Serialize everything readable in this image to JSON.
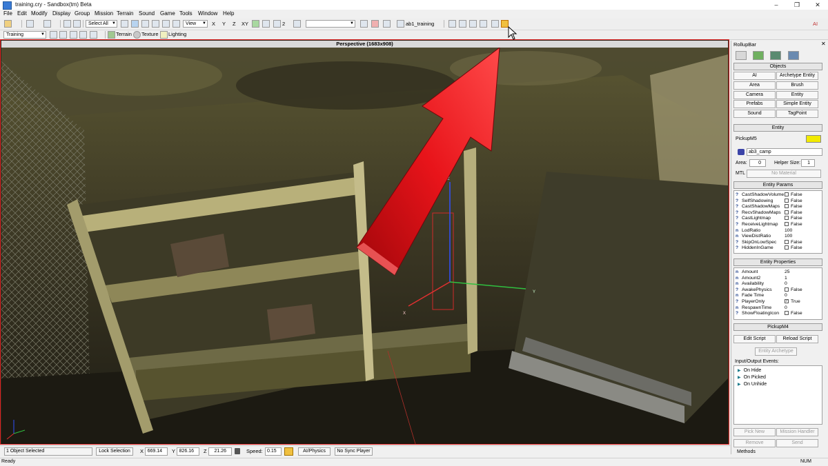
{
  "window": {
    "title": "training.cry - Sandbox(tm) Beta",
    "controls": [
      "–",
      "❐",
      "✕"
    ]
  },
  "menu": [
    "File",
    "Edit",
    "Modify",
    "Display",
    "Group",
    "Mission",
    "Terrain",
    "Sound",
    "Game",
    "Tools",
    "Window",
    "Help"
  ],
  "toolbar1": {
    "select_all_label": "Select All",
    "view_label": "View",
    "axes": [
      "X",
      "Y",
      "Z",
      "XY"
    ],
    "grid_value": "2",
    "layer_name": "ab1_training",
    "ai_label": "AI"
  },
  "toolbar2": {
    "mission_select": "Training",
    "terrain_label": "Terrain",
    "texture_label": "Texture",
    "lighting_label": "Lighting"
  },
  "viewport": {
    "title": "Perspective (1683x908)",
    "gizmo_axes": [
      "Z",
      "X",
      "Y"
    ]
  },
  "rollup": {
    "title": "RollupBar",
    "objects_header": "Objects",
    "object_buttons": [
      "AI",
      "Archetype Entity",
      "Area",
      "Brush",
      "Camera",
      "Entity",
      "Prefabs",
      "Simple Entity",
      "Sound",
      "TagPoint"
    ],
    "entity_header": "Entity",
    "entity_name": "PickupM5",
    "entity_color": "#f2ea00",
    "entity_material": "ab3_camp",
    "area_label": "Area:",
    "area_value": "0",
    "helper_size_label": "Helper Size:",
    "helper_size_value": "1",
    "mtl_label": "MTL",
    "no_material": "No Material",
    "entity_params_header": "Entity Params",
    "entity_params": [
      {
        "q": "?",
        "name": "CastShadowVolume",
        "value": "False"
      },
      {
        "q": "?",
        "name": "SelfShadowing",
        "value": "False"
      },
      {
        "q": "?",
        "name": "CastShadowMaps",
        "value": "False"
      },
      {
        "q": "?",
        "name": "RecvShadowMaps",
        "value": "False"
      },
      {
        "q": "?",
        "name": "CastLightmap",
        "value": "False"
      },
      {
        "q": "?",
        "name": "ReceiveLightmap",
        "value": "False"
      },
      {
        "q": "n",
        "name": "LodRatio",
        "value": "100"
      },
      {
        "q": "n",
        "name": "ViewDistRatio",
        "value": "100"
      },
      {
        "q": "?",
        "name": "SkipOnLowSpec",
        "value": "False"
      },
      {
        "q": "?",
        "name": "HiddenInGame",
        "value": "False"
      }
    ],
    "entity_properties_header": "Entity Properties",
    "entity_properties": [
      {
        "q": "n",
        "name": "Amount",
        "value": "25"
      },
      {
        "q": "n",
        "name": "Amount2",
        "value": "1"
      },
      {
        "q": "n",
        "name": "Availability",
        "value": "0"
      },
      {
        "q": "?",
        "name": "AwakePhysics",
        "value": "False"
      },
      {
        "q": "n",
        "name": "Fade Time",
        "value": "0"
      },
      {
        "q": "?",
        "name": "PlayerOnly",
        "value": "True"
      },
      {
        "q": "n",
        "name": "RespawnTime",
        "value": "0"
      },
      {
        "q": "?",
        "name": "ShowFloatingIcon",
        "value": "False"
      }
    ],
    "pickup_header": "PickupM4",
    "edit_script": "Edit Script",
    "reload_script": "Reload Script",
    "entity_archetype": "Entity Archetype",
    "io_events_label": "Input/Output Events:",
    "events": [
      "On Hide",
      "On Picked",
      "On Unhide"
    ],
    "pick_new": "Pick New",
    "mission_handler": "Mission Handler",
    "remove": "Remove",
    "send": "Send",
    "methods_label": "Methods"
  },
  "statusbar": {
    "selection": "1 Object Selected",
    "lock_selection": "Lock Selection",
    "x_label": "X",
    "x_value": "669.14",
    "y_label": "Y",
    "y_value": "826.16",
    "z_label": "Z",
    "z_value": "21.26",
    "speed_label": "Speed:",
    "speed_value": "0.15",
    "ai_physics": "AI/Physics",
    "no_sync": "No Sync Player"
  },
  "bottom": {
    "ready": "Ready",
    "num": "NUM"
  },
  "colors": {
    "viewport_border": "#e02020",
    "arrow_red": "#e8141a",
    "gizmo_x": "#e03030",
    "gizmo_y": "#30c040",
    "gizmo_z": "#3050ff"
  }
}
